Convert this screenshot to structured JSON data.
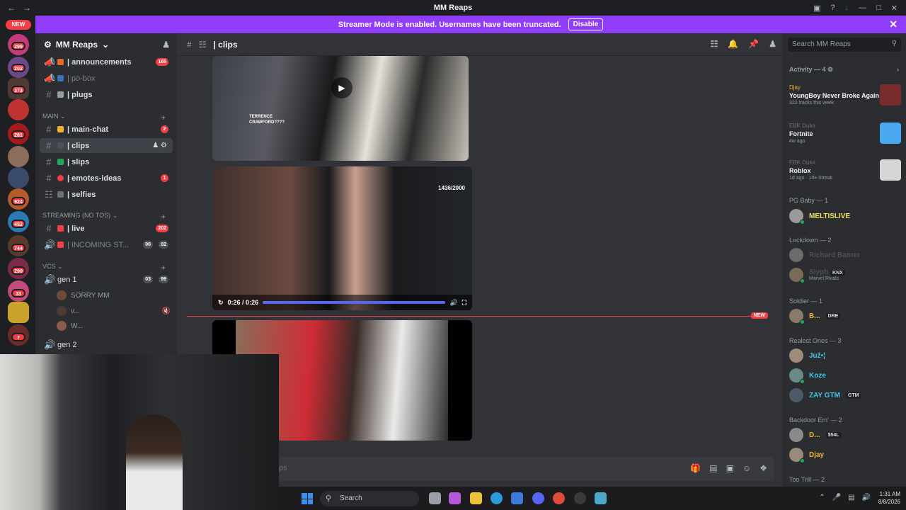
{
  "window": {
    "title": "MM Reaps"
  },
  "banner": {
    "text": "Streamer Mode is enabled. Usernames have been truncated.",
    "button": "Disable"
  },
  "servers": {
    "new_label": "NEW",
    "badges": [
      "299",
      "202",
      "373",
      "281",
      "924",
      "452",
      "744",
      "290",
      "33",
      "7"
    ]
  },
  "server": {
    "name": "MM Reaps"
  },
  "channels": {
    "top": [
      {
        "label": "| announcements",
        "badge": "165"
      },
      {
        "label": "| po-box",
        "badge": ""
      },
      {
        "label": "| plugs",
        "badge": ""
      }
    ],
    "main_category": "MAIN",
    "main": [
      {
        "label": "| main-chat",
        "badge": "2"
      },
      {
        "label": "| clips",
        "badge": ""
      },
      {
        "label": "| slips",
        "badge": ""
      },
      {
        "label": "| emotes-ideas",
        "badge": "1"
      },
      {
        "label": "| selfies",
        "badge": ""
      }
    ],
    "streaming_category": "STREAMING (NO TOS)",
    "streaming": [
      {
        "label": "| live",
        "badge": "202"
      },
      {
        "label": "| INCOMING ST...",
        "badge_a": "00",
        "badge_b": "02"
      }
    ],
    "vc_category": "VCs",
    "vc": [
      {
        "label": "gen 1",
        "badge_a": "03",
        "badge_b": "99"
      },
      {
        "label": "gen 2"
      }
    ],
    "vc_users": [
      "SORRY MM",
      "v...",
      "W..."
    ]
  },
  "header": {
    "channel": "| clips"
  },
  "media": {
    "vid1_overlay": [
      "TERRENCE",
      "CRAWFORD????"
    ],
    "vid2_time": "0:26 / 0:26",
    "vid2_progress": 1.0,
    "vid2_views": "1436/2000",
    "new_marker": "NEW"
  },
  "composer": {
    "placeholder": "ps"
  },
  "sidebar": {
    "search_placeholder": "Search MM Reaps",
    "activity_title": "Activity — 4",
    "activities": [
      {
        "who": "Djay",
        "what": "YoungBoy Never Broke Again",
        "sub": "322 tracks this week"
      },
      {
        "who": "EBK Duke",
        "what": "Fortnite",
        "sub": "4w ago"
      },
      {
        "who": "EBK Duke",
        "what": "Roblox",
        "sub": "1d ago · 10x Streak"
      }
    ],
    "groups": [
      {
        "role": "PG Baby — 1",
        "members": [
          {
            "name": "MELTISLIVE",
            "color": "#f0e15a"
          }
        ]
      },
      {
        "role": "Lockdown — 2",
        "members": [
          {
            "name": "Richard Barner",
            "color": "#4e5058"
          },
          {
            "name": "Slyph",
            "color": "#4e5058",
            "tag": "KNX",
            "sub": "Marvel Rivals"
          }
        ]
      },
      {
        "role": "Soldier — 1",
        "members": [
          {
            "name": "B...",
            "color": "#f0b232",
            "tag": "DRE"
          }
        ]
      },
      {
        "role": "Realest Ones — 3",
        "members": [
          {
            "name": "Juž•¦",
            "color": "#3fc8e8"
          },
          {
            "name": "Koze",
            "color": "#3fc8e8"
          },
          {
            "name": "ZAY GTM",
            "color": "#3fc8e8",
            "tag": "GTM"
          }
        ]
      },
      {
        "role": "Backdoor Em' — 2",
        "members": [
          {
            "name": "D...",
            "color": "#f0b232",
            "tag": "$54L"
          },
          {
            "name": "Djay",
            "color": "#f0b232"
          }
        ]
      },
      {
        "role": "Too Trill — 2",
        "members": []
      }
    ]
  },
  "taskbar": {
    "search": "Search",
    "time": "1:31 AM",
    "date": "8/8/2026"
  },
  "colors": {
    "accent": "#8f3dfa",
    "danger": "#f23f43",
    "blurple": "#5865f2"
  }
}
